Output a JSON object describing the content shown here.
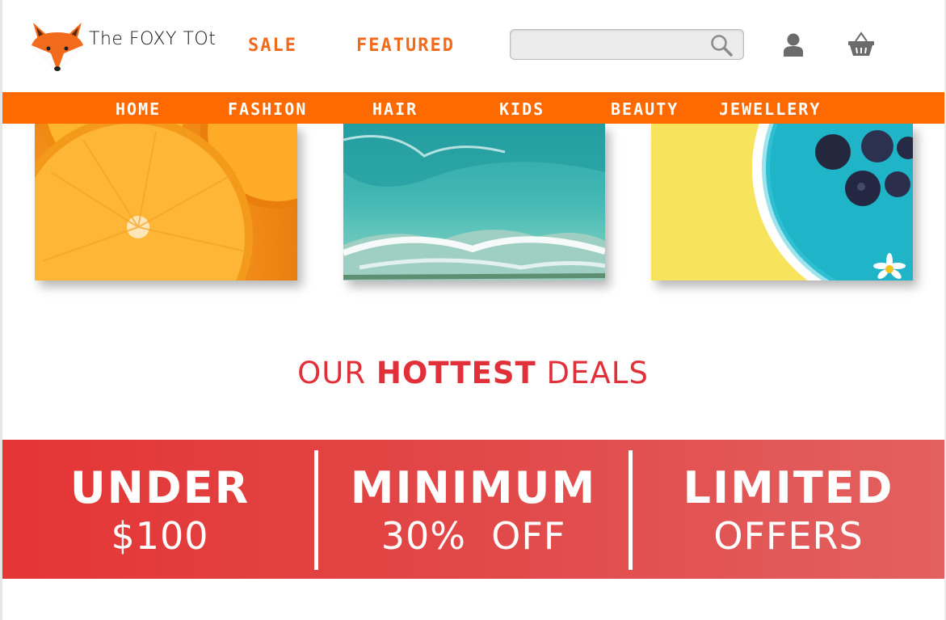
{
  "header": {
    "brand": "The FOXY TOt",
    "links": {
      "sale": "SALE",
      "featured": "FEATURED"
    },
    "search": {
      "placeholder": "",
      "value": ""
    },
    "icons": {
      "logo": "fox-logo-icon",
      "search": "search-icon",
      "user": "user-icon",
      "cart": "basket-icon"
    }
  },
  "nav": {
    "items": [
      {
        "label": "HOME"
      },
      {
        "label": "FASHION"
      },
      {
        "label": "HAIR"
      },
      {
        "label": "KIDS"
      },
      {
        "label": "BEAUTY"
      },
      {
        "label": "JEWELLERY"
      }
    ]
  },
  "cards": [
    {
      "name": "orange-slices-image"
    },
    {
      "name": "ocean-wave-image"
    },
    {
      "name": "blueberry-bowl-image"
    }
  ],
  "deals": {
    "title_pre": "OUR ",
    "title_bold": "HOTTEST",
    "title_post": " DEALS",
    "items": [
      {
        "line1": "UNDER",
        "line2": "$100"
      },
      {
        "line1": "MINIMUM",
        "line2": "30%  OFF"
      },
      {
        "line1": "LIMITED",
        "line2": "OFFERS"
      }
    ]
  },
  "colors": {
    "accent_orange": "#ff6a00",
    "link_orange": "#f26a1b",
    "deals_red": "#e2303a",
    "banner_red": "#e43535"
  }
}
